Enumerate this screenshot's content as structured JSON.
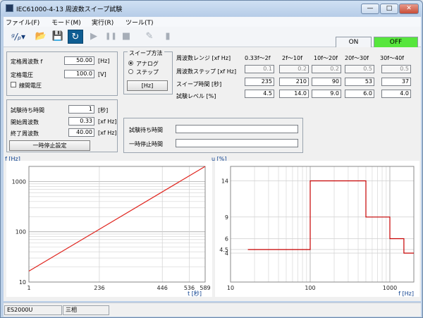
{
  "window": {
    "title": "IEC61000-4-13 周波数スイープ試験",
    "controls": [
      "—",
      "□",
      "✕"
    ]
  },
  "menus": [
    "ファイル(F)",
    "モード(M)",
    "実行(R)",
    "ツール(T)"
  ],
  "toolbar": {
    "items": [
      "logo-icon",
      "open-folder-icon",
      "save-icon",
      "refresh-icon",
      "play-icon",
      "pause-icon",
      "stop-icon",
      "edit-icon",
      "panel-icon"
    ],
    "on_label": "ON",
    "off_label": "OFF",
    "off_color": "#57e63d"
  },
  "left_panel": {
    "rated_freq_label": "定格周波数 f",
    "rated_freq_value": "50.00",
    "rated_freq_unit": "[Hz]",
    "rated_volt_label": "定格電圧",
    "rated_volt_value": "100.0",
    "rated_volt_unit": "[V]",
    "line_voltage_label": "線間電圧",
    "wait_time_label": "試験待ち時間",
    "wait_time_value": "1",
    "wait_time_unit": "[秒]",
    "start_freq_label": "開始周波数",
    "start_freq_value": "0.33",
    "start_freq_unit": "[xf Hz]",
    "end_freq_label": "終了周波数",
    "end_freq_value": "40.00",
    "end_freq_unit": "[xf Hz]",
    "pause_button": "一時停止設定"
  },
  "sweep_method": {
    "legend": "スイープ方法",
    "analog": "アナログ",
    "step": "ステップ",
    "hz_button": "[Hz]"
  },
  "param_table": {
    "row_labels": [
      "周波数レンジ [xf Hz]",
      "周波数ステップ [xf Hz]",
      "スイープ時間 [秒]",
      "試験レベル [%]"
    ],
    "columns": [
      "0.33f〜2f",
      "2f〜10f",
      "10f〜20f",
      "20f〜30f",
      "30f〜40f"
    ],
    "step": [
      "0.1",
      "0.2",
      "0.2",
      "0.5",
      "0.5"
    ],
    "time": [
      "235",
      "210",
      "90",
      "53",
      "37"
    ],
    "level": [
      "4.5",
      "14.0",
      "9.0",
      "6.0",
      "4.0"
    ]
  },
  "status_panel": {
    "wait_label": "試験待ち時間",
    "pause_label": "一時停止時間"
  },
  "chart_left": {
    "ylabel": "f [Hz]",
    "xlabel": "t [秒]",
    "yticks": [
      "1000",
      "100",
      "10"
    ],
    "xticks": [
      "1",
      "236",
      "446",
      "536",
      "589"
    ],
    "line_color": "#e0261f"
  },
  "chart_right": {
    "ylabel": "u [%]",
    "xlabel": "f [Hz]",
    "yticks": [
      "14",
      "9",
      "6",
      "4.5",
      "4"
    ],
    "xticks": [
      "10",
      "100",
      "1000"
    ],
    "line_color": "#c60000"
  },
  "chart_data": [
    {
      "type": "line",
      "xlabel": "t [秒]",
      "ylabel": "f [Hz]",
      "y_scale": "log",
      "x": [
        1,
        589
      ],
      "y": [
        16.5,
        2000
      ],
      "xlim": [
        1,
        589
      ],
      "ylim": [
        10,
        2000
      ],
      "grid": true
    },
    {
      "type": "line",
      "xlabel": "f [Hz]",
      "ylabel": "u [%]",
      "x_scale": "log",
      "x": [
        16.5,
        100,
        100,
        500,
        500,
        1000,
        1000,
        1500,
        1500,
        2000
      ],
      "y": [
        4.5,
        4.5,
        14,
        14,
        9,
        9,
        6,
        6,
        4,
        4
      ],
      "xlim": [
        10,
        2000
      ],
      "ylim": [
        0,
        16
      ],
      "grid": true
    }
  ],
  "statusbar": {
    "model": "ES2000U",
    "phase": "三相"
  }
}
